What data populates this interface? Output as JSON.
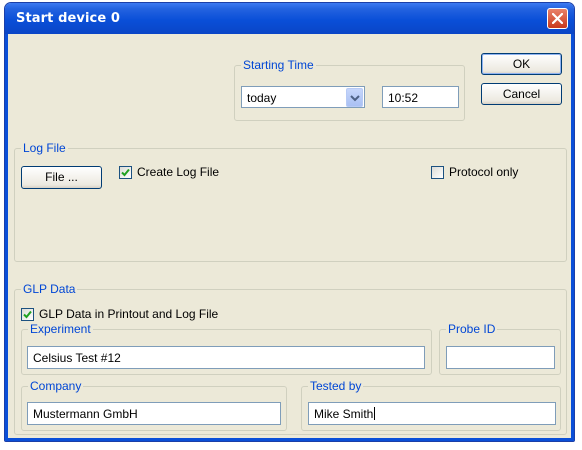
{
  "window": {
    "title": "Start device 0"
  },
  "buttons": {
    "ok": "OK",
    "cancel": "Cancel",
    "file": "File ..."
  },
  "starting_time": {
    "legend": "Starting Time",
    "day": "today",
    "time": "10:52"
  },
  "log_file": {
    "legend": "Log File",
    "create_label": "Create Log File",
    "create_checked": true,
    "protocol_label": "Protocol only",
    "protocol_checked": false
  },
  "glp": {
    "legend": "GLP Data",
    "printout_label": "GLP Data in Printout and Log File",
    "printout_checked": true,
    "experiment": {
      "legend": "Experiment",
      "value": "Celsius Test #12"
    },
    "probe_id": {
      "legend": "Probe ID",
      "value": ""
    },
    "company": {
      "legend": "Company",
      "value": "Mustermann GmbH"
    },
    "tested_by": {
      "legend": "Tested by",
      "value": "Mike Smith"
    }
  },
  "colors": {
    "title_bar": "#0a4fd8",
    "dialog_bg": "#ece9d8",
    "group_legend": "#0046d5",
    "close_button": "#d6512d"
  }
}
